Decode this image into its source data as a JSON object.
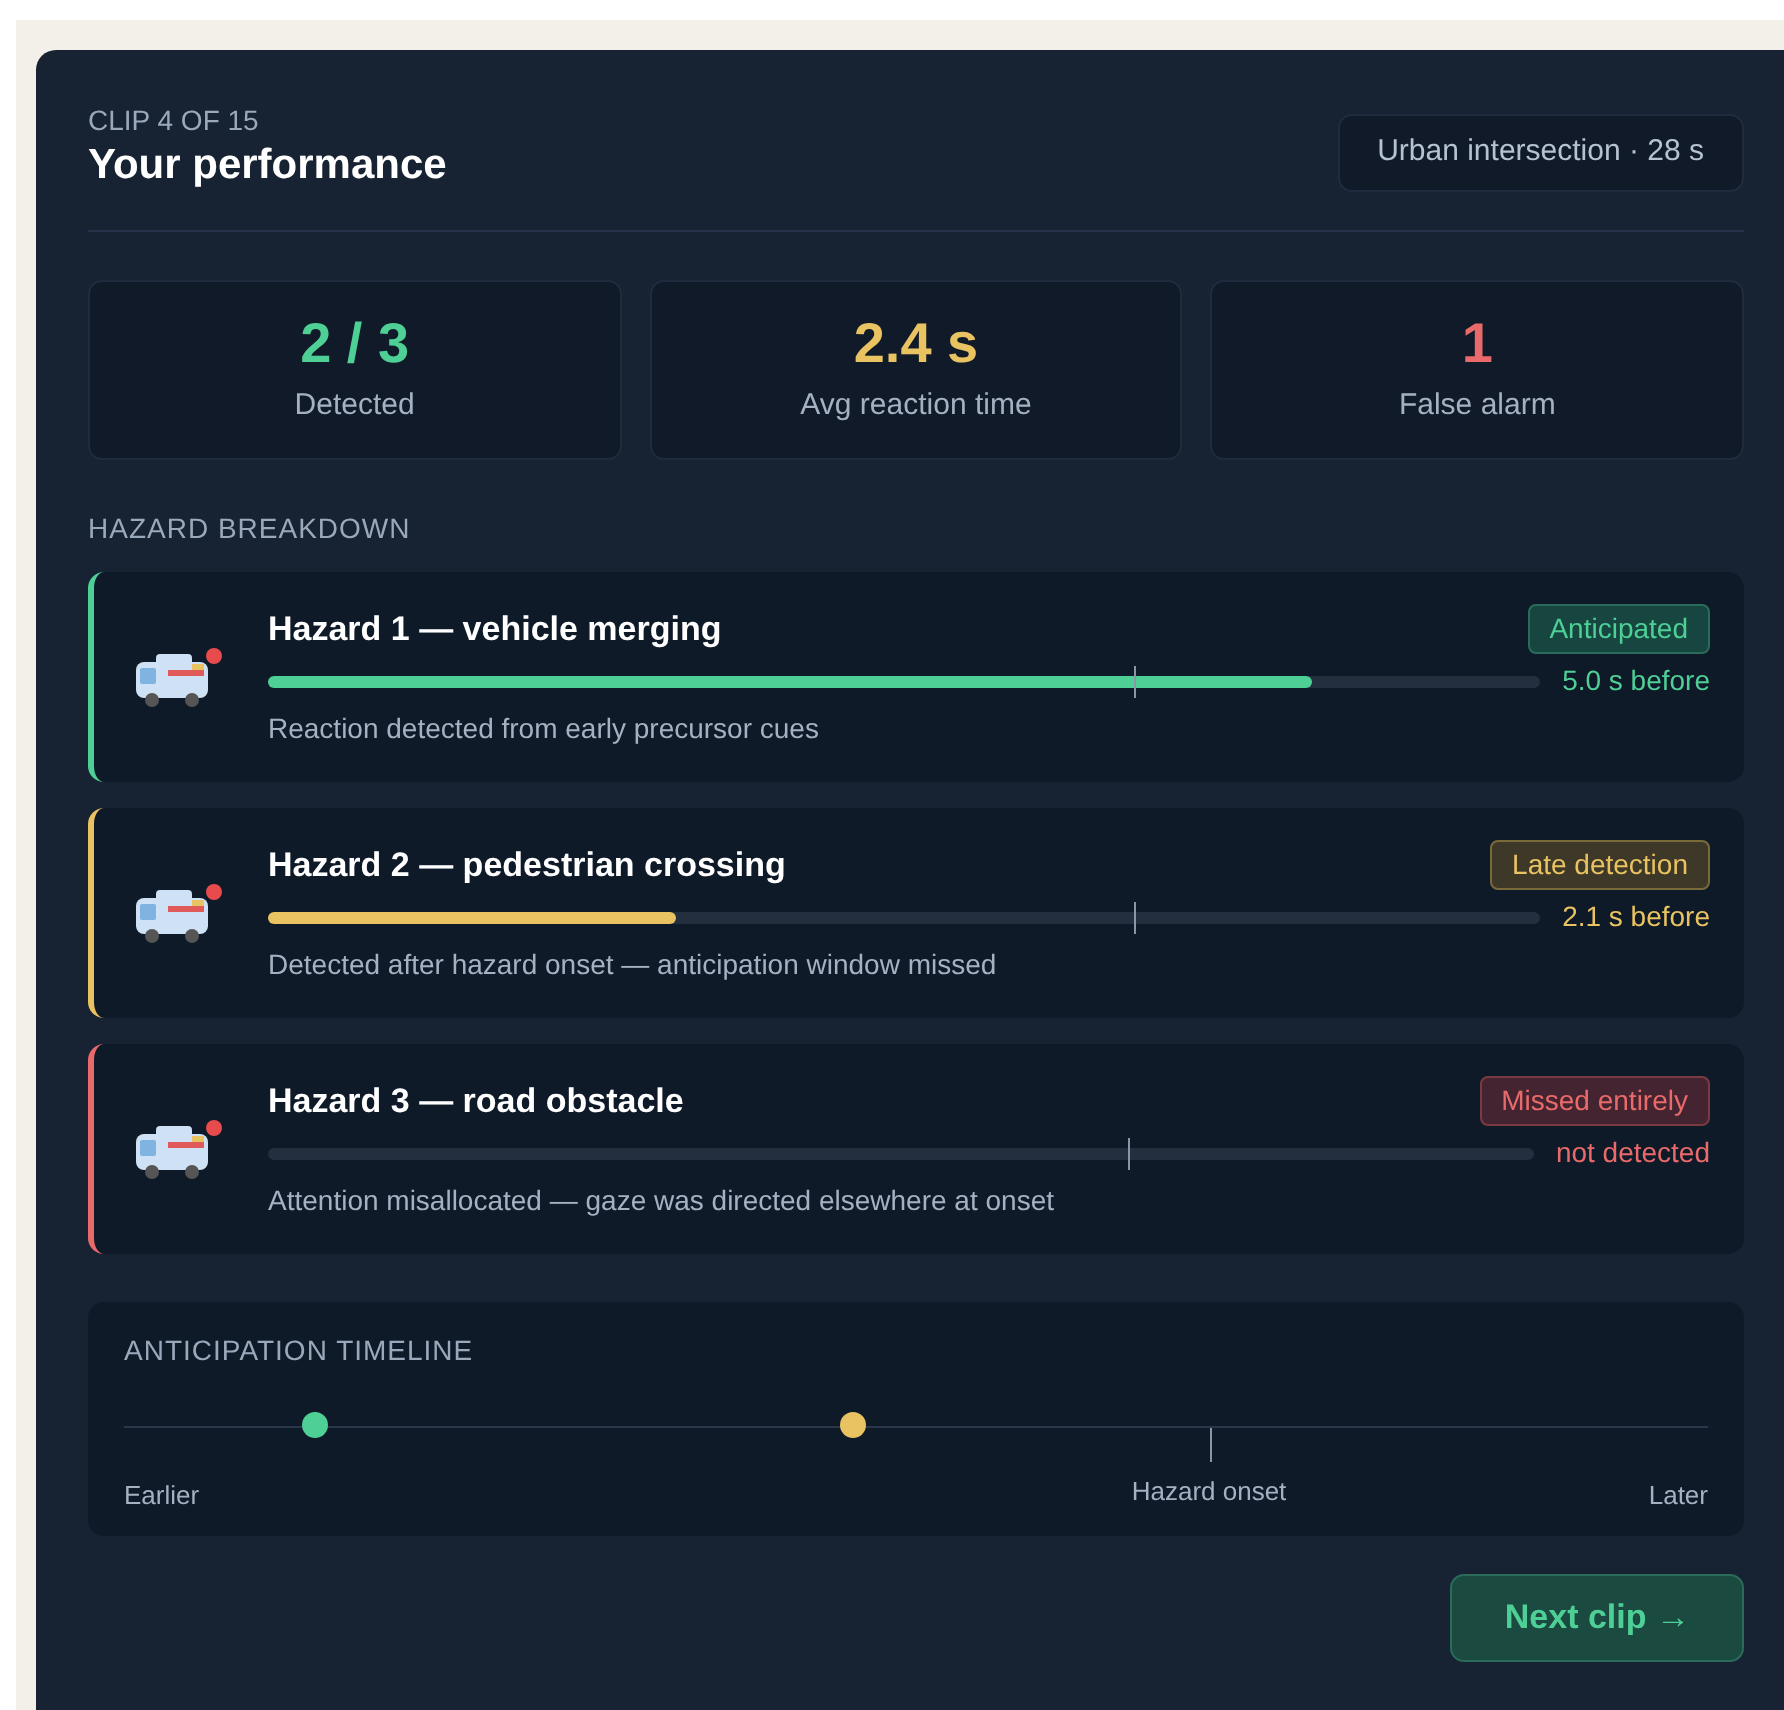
{
  "header": {
    "eyebrow": "CLIP 4 OF 15",
    "title": "Your performance",
    "clip_tag": "Urban intersection · 28 s"
  },
  "stats": [
    {
      "value": "2 / 3",
      "label": "Detected",
      "kind": "good"
    },
    {
      "value": "2.4 s",
      "label": "Avg reaction time",
      "kind": "warn"
    },
    {
      "value": "1",
      "label": "False alarm",
      "kind": "bad"
    }
  ],
  "breakdown": {
    "heading": "HAZARD BREAKDOWN",
    "hazards": [
      {
        "title": "Hazard 1 — vehicle merging",
        "kind": "anticipated",
        "badge": "Anticipated",
        "level": 0.82,
        "reading": "5.0 s before",
        "note": "Reaction detected from early precursor cues"
      },
      {
        "title": "Hazard 2 — pedestrian crossing",
        "kind": "late",
        "badge": "Late detection",
        "level": 0.32,
        "reading": "2.1 s before",
        "note": "Detected after hazard onset — anticipation window missed"
      },
      {
        "title": "Hazard 3 — road obstacle",
        "kind": "missed",
        "badge": "Missed entirely",
        "reading": "not detected",
        "note": "Attention misallocated — gaze was directed elsewhere at onset"
      }
    ]
  },
  "timeline": {
    "heading": "ANTICIPATION TIMELINE",
    "markers": [
      {
        "color": "#4ecf96",
        "level": 0.12
      },
      {
        "color": "#e9c261",
        "level": 0.46
      }
    ],
    "start_label": "Earlier",
    "onset_label": "Hazard onset",
    "end_label": "Later"
  },
  "next_button": "Next clip →"
}
